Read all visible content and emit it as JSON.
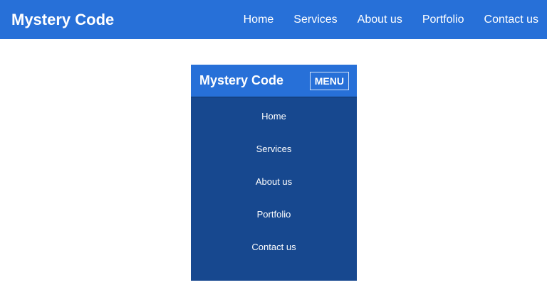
{
  "desktop": {
    "brand": "Mystery Code",
    "nav": [
      "Home",
      "Services",
      "About us",
      "Portfolio",
      "Contact us"
    ]
  },
  "mobile": {
    "brand": "Mystery Code",
    "menu_button": "MENU",
    "nav": [
      "Home",
      "Services",
      "About us",
      "Portfolio",
      "Contact us"
    ]
  },
  "colors": {
    "header_blue": "#2770d8",
    "menu_dark_blue": "#17488f",
    "text": "#ffffff"
  }
}
